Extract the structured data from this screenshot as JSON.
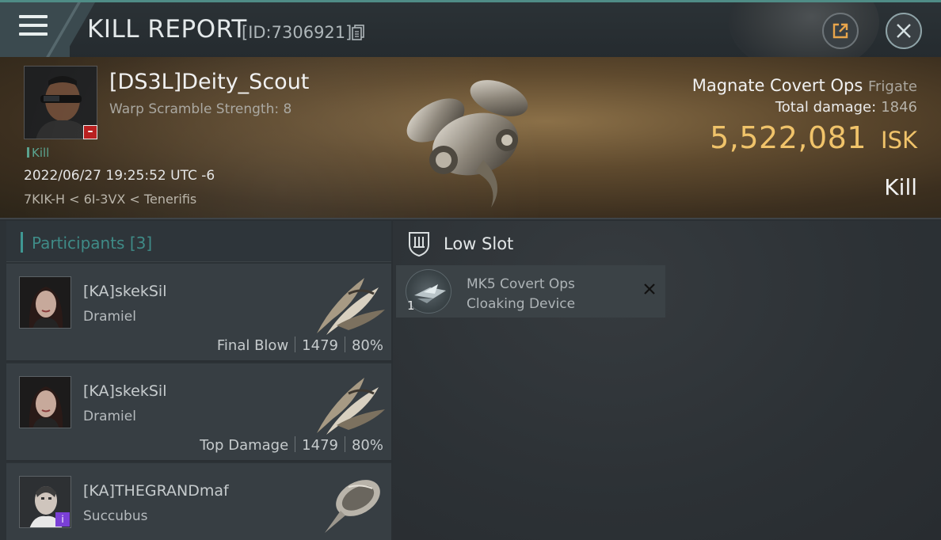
{
  "header": {
    "title": "KILL REPORT",
    "id_text": "[ID:7306921]"
  },
  "victim": {
    "name": "[DS3L]Deity_Scout",
    "warp_scramble": "Warp Scramble Strength: 8",
    "kill_tag": "Kill",
    "timestamp": "2022/06/27 19:25:52 UTC -6",
    "location": "7KIK-H < 6I-3VX < Tenerifis"
  },
  "ship": {
    "name": "Magnate Covert Ops",
    "class": "Frigate",
    "total_damage_label": "Total damage:",
    "total_damage_value": "1846",
    "isk_value": "5,522,081",
    "isk_unit": "ISK",
    "result": "Kill"
  },
  "participants": {
    "title": "Participants",
    "count": "[3]",
    "rows": [
      {
        "name": "[KA]skekSil",
        "ship": "Dramiel",
        "label": "Final Blow",
        "damage": "1479",
        "percent": "80%"
      },
      {
        "name": "[KA]skekSil",
        "ship": "Dramiel",
        "label": "Top Damage",
        "damage": "1479",
        "percent": "80%"
      },
      {
        "name": "[KA]THEGRANDmaf",
        "ship": "Succubus"
      }
    ]
  },
  "low_slot": {
    "title": "Low Slot",
    "module_name": "MK5 Covert Ops Cloaking Device",
    "quantity": "1"
  },
  "colors": {
    "accent_teal": "#3f8b87",
    "isk_gold": "#f0c36a",
    "victim_badge_red": "#b81d1d",
    "participant_badge_purple": "#7a3fd6"
  },
  "icons": [
    "menu-icon",
    "copy-icon",
    "share-icon",
    "close-icon",
    "low-slot-icon",
    "remove-icon"
  ]
}
